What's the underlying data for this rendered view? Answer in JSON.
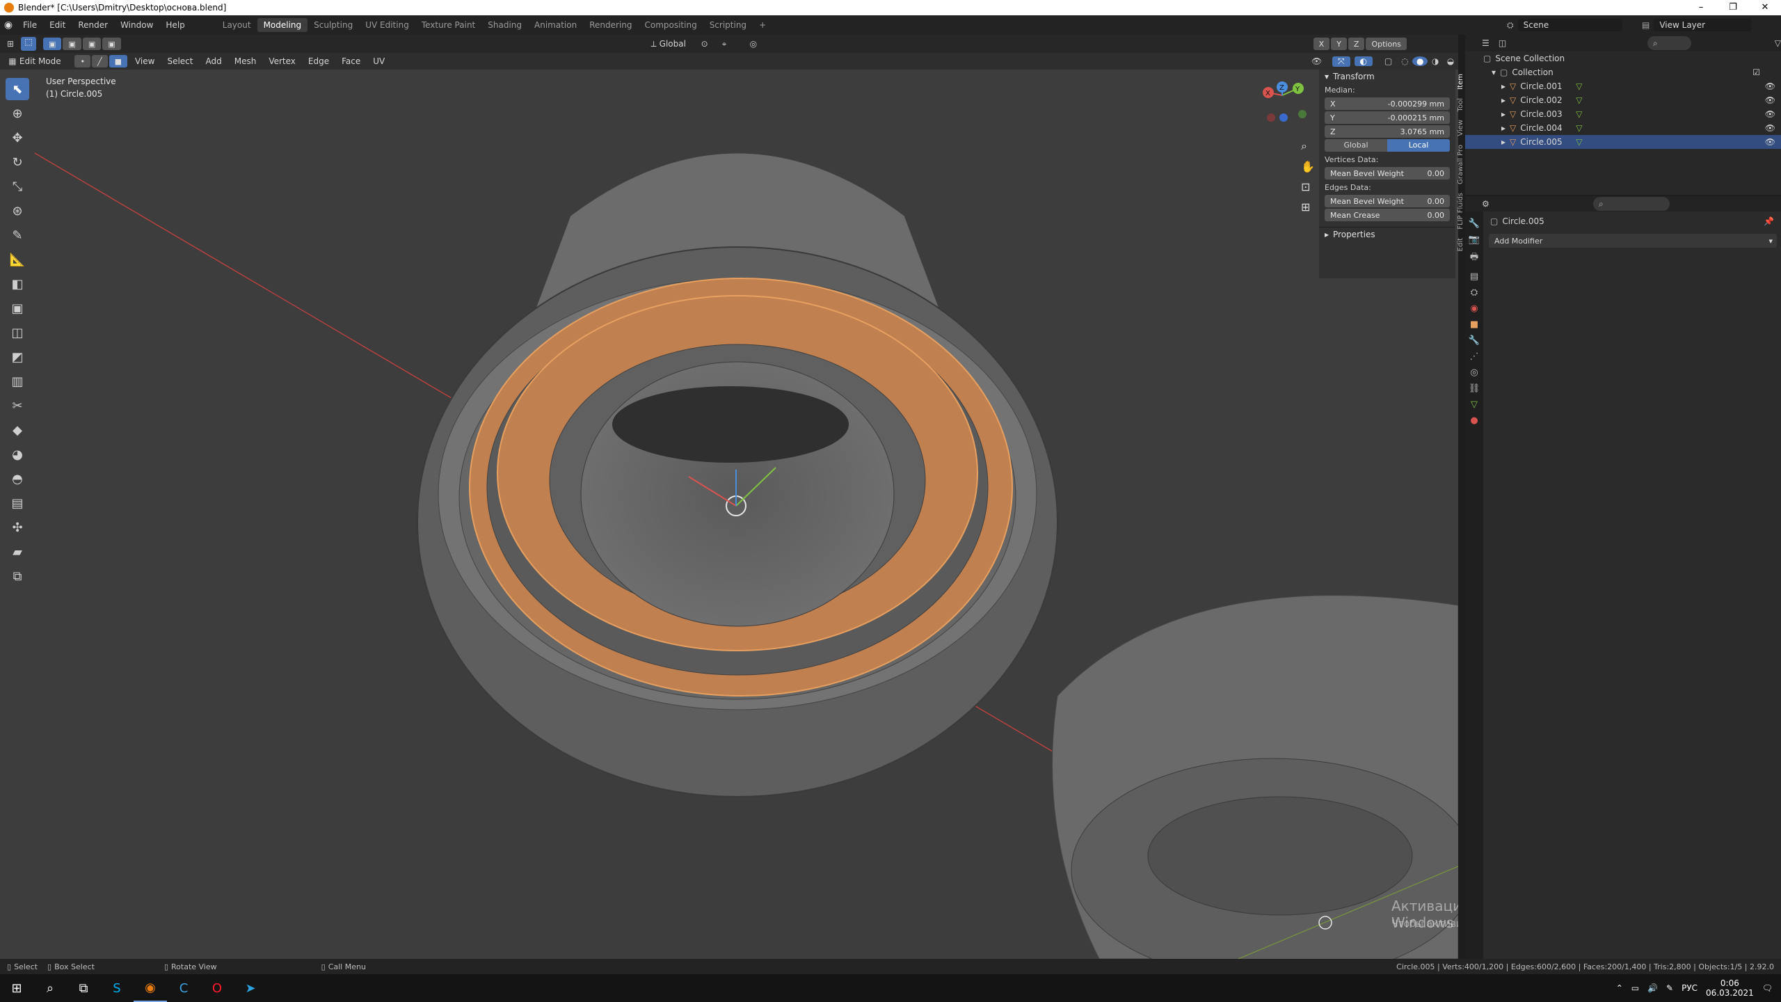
{
  "window": {
    "title": "Blender* [C:\\Users\\Dmitry\\Desktop\\основа.blend]",
    "controls": [
      "–",
      "❐",
      "✕"
    ]
  },
  "menubar": {
    "items": [
      "File",
      "Edit",
      "Render",
      "Window",
      "Help"
    ],
    "workspaces": [
      "Layout",
      "Modeling",
      "Sculpting",
      "UV Editing",
      "Texture Paint",
      "Shading",
      "Animation",
      "Rendering",
      "Compositing",
      "Scripting"
    ],
    "active_workspace": "Modeling",
    "add_tab": "+",
    "scene_label": "Scene",
    "view_layer_label": "View Layer"
  },
  "viewport_header": {
    "transform_orientation": "Global",
    "axes": [
      "X",
      "Y",
      "Z"
    ],
    "options_label": "Options",
    "mode": "Edit Mode",
    "menus": [
      "View",
      "Select",
      "Add",
      "Mesh",
      "Vertex",
      "Edge",
      "Face",
      "UV"
    ]
  },
  "viewport": {
    "perspective": "User Perspective",
    "object_label": "(1) Circle.005",
    "gizmo_axes": [
      "X",
      "Y",
      "Z"
    ],
    "watermark_title": "Активация Windows",
    "watermark_text": "Чтобы активировать Windows, перейдите в раздел \"Параметры\"."
  },
  "npanel": {
    "section_title": "Transform",
    "median_label": "Median:",
    "fields": [
      {
        "label": "X",
        "value": "-0.000299 mm"
      },
      {
        "label": "Y",
        "value": "-0.000215 mm"
      },
      {
        "label": "Z",
        "value": "3.0765 mm"
      }
    ],
    "global_label": "Global",
    "local_label": "Local",
    "vertices_data_label": "Vertices Data:",
    "mean_bevel_vertex": {
      "label": "Mean Bevel Weight",
      "value": "0.00"
    },
    "edges_data_label": "Edges Data:",
    "mean_bevel_edge": {
      "label": "Mean Bevel Weight",
      "value": "0.00"
    },
    "mean_crease": {
      "label": "Mean Crease",
      "value": "0.00"
    },
    "properties_label": "Properties",
    "tabs": [
      "Item",
      "Tool",
      "View",
      "Grawall Pro",
      "FLIP Fluids",
      "Edit"
    ]
  },
  "outliner": {
    "scene_collection": "Scene Collection",
    "collection": "Collection",
    "objects": [
      "Circle.001",
      "Circle.002",
      "Circle.003",
      "Circle.004",
      "Circle.005"
    ],
    "selected": "Circle.005"
  },
  "properties": {
    "object_name": "Circle.005",
    "add_modifier": "Add Modifier"
  },
  "statusbar": {
    "select": "Select",
    "box_select": "Box Select",
    "rotate_view": "Rotate View",
    "call_menu": "Call Menu",
    "stats": "Circle.005 | Verts:400/1,200 | Edges:600/2,600 | Faces:200/1,400 | Tris:2,800 | Objects:1/5 | 2.92.0"
  },
  "taskbar": {
    "lang": "РУС",
    "time": "0:06",
    "date": "06.03.2021"
  },
  "colors": {
    "accent": "#4772b3",
    "selection": "#e8a060",
    "viewport_bg": "#3d3d3d",
    "panel_bg": "#303030"
  }
}
